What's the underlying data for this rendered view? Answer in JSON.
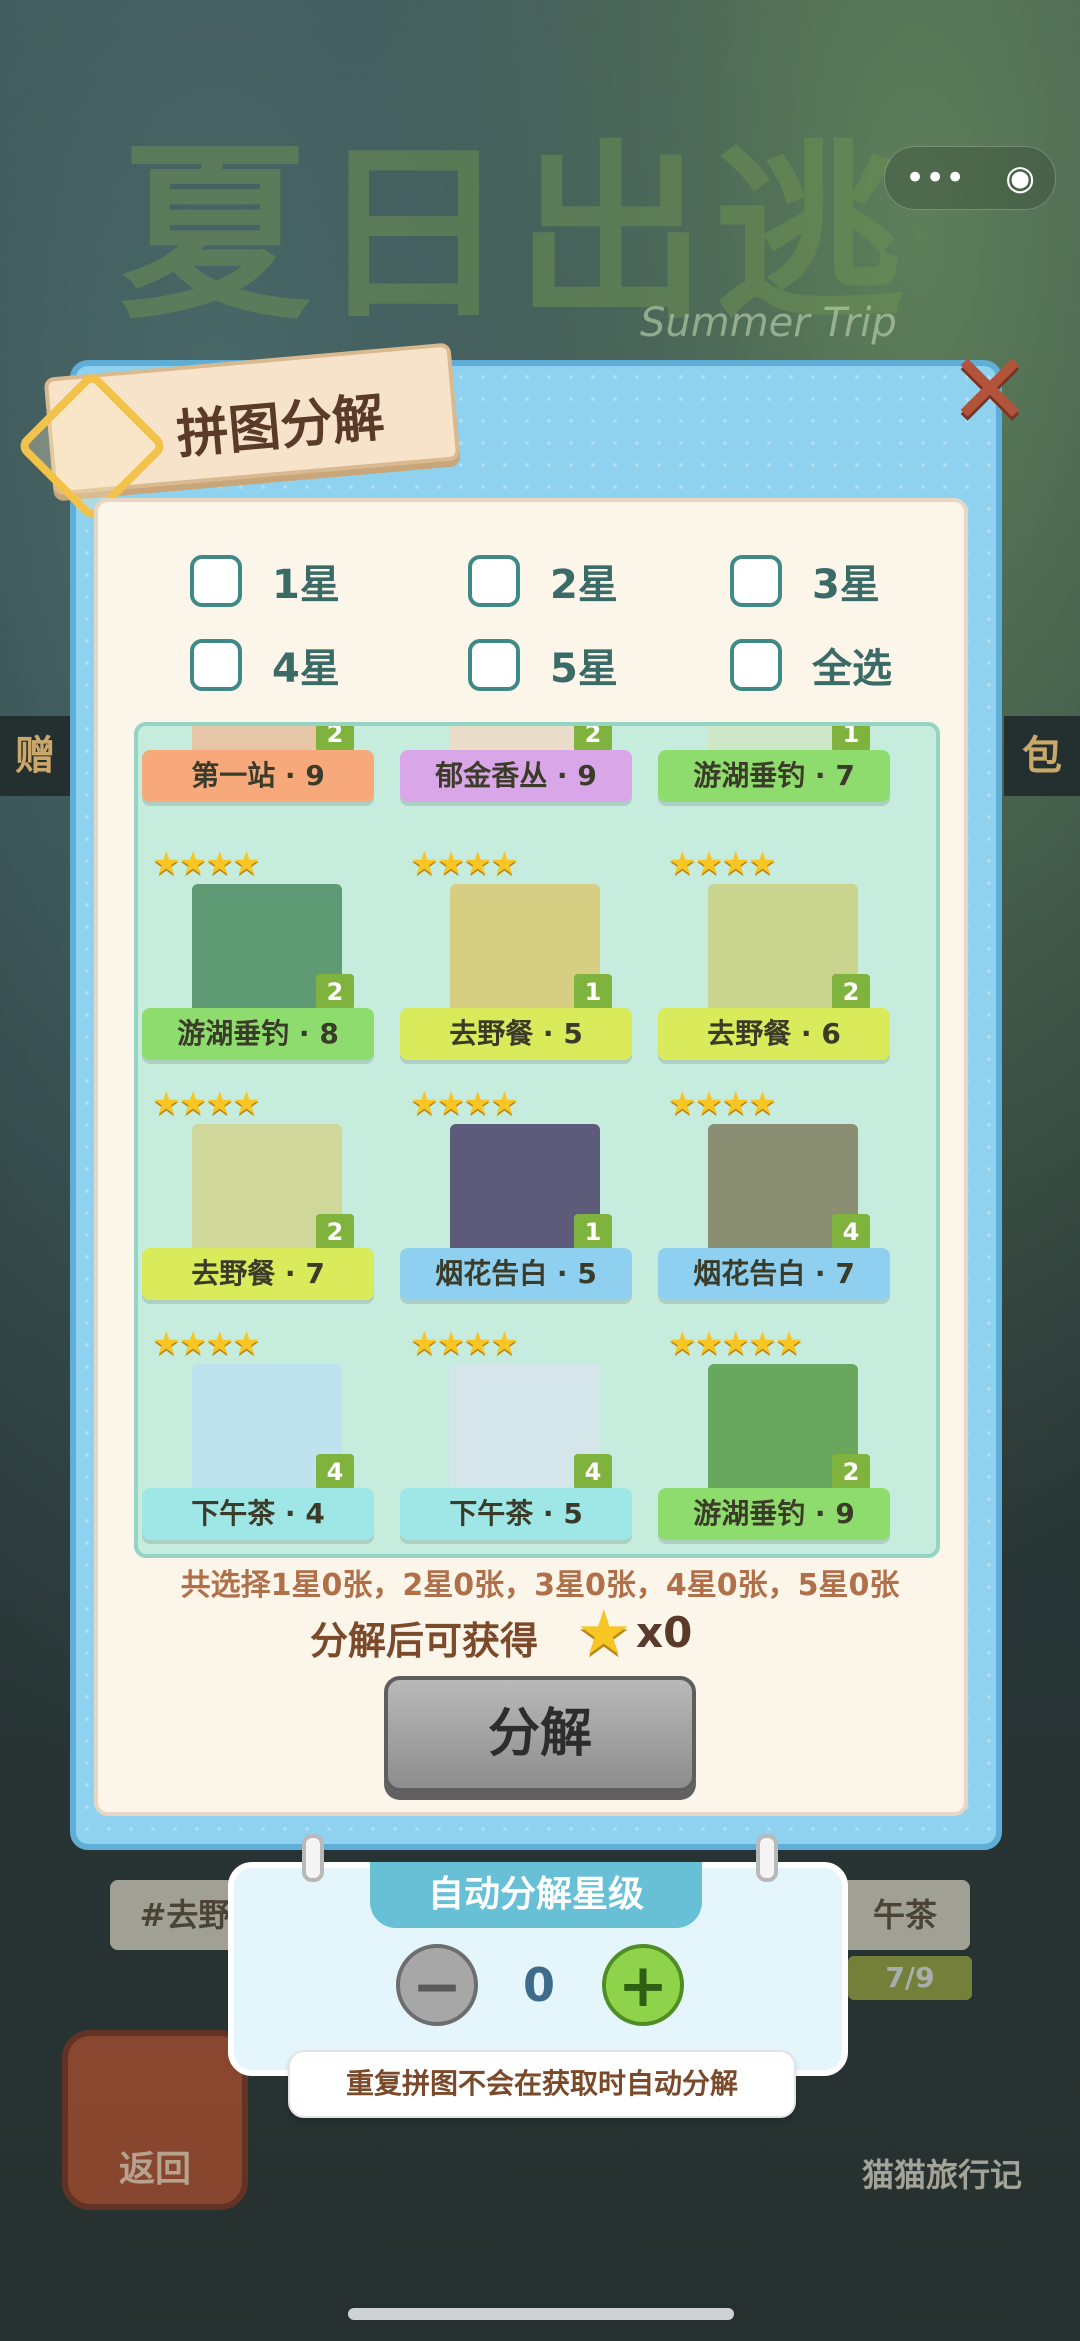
{
  "capsule": {
    "more": "•••",
    "target": "◉"
  },
  "background": {
    "title_art": "夏日出逃记",
    "title_sub": "Summer Trip",
    "left_tab": "赠",
    "right_tab": "包",
    "back_label": "返回",
    "logo": "猫猫旅行记",
    "bottom_left_tag": "#去野",
    "bottom_right_tag": "午茶",
    "progress_fragment": "7/9"
  },
  "modal": {
    "title": "拼图分解",
    "close_icon": "close-x-icon",
    "filters": [
      {
        "label": "1星"
      },
      {
        "label": "2星"
      },
      {
        "label": "3星"
      },
      {
        "label": "4星"
      },
      {
        "label": "5星"
      },
      {
        "label": "全选"
      }
    ],
    "cards": [
      {
        "name": "第一站 · 9",
        "stars": "",
        "count": "2",
        "ribbon_color": "#f7a97c",
        "art": "#e6c6a6"
      },
      {
        "name": "郁金香丛 · 9",
        "stars": "",
        "count": "2",
        "ribbon_color": "#d9a7e8",
        "art": "#e9dcc8"
      },
      {
        "name": "游湖垂钓 · 7",
        "stars": "",
        "count": "1",
        "ribbon_color": "#8fdc6e",
        "art": "#cfe7c9"
      },
      {
        "name": "游湖垂钓 · 8",
        "stars": "★★★★",
        "count": "2",
        "ribbon_color": "#8fdc6e",
        "art": "#5e9a73"
      },
      {
        "name": "去野餐 · 5",
        "stars": "★★★★",
        "count": "1",
        "ribbon_color": "#d9ea5a",
        "art": "#d6cf83"
      },
      {
        "name": "去野餐 · 6",
        "stars": "★★★★",
        "count": "2",
        "ribbon_color": "#d9ea5a",
        "art": "#c9d48e"
      },
      {
        "name": "去野餐 · 7",
        "stars": "★★★★",
        "count": "2",
        "ribbon_color": "#d9ea5a",
        "art": "#cfd79a"
      },
      {
        "name": "烟花告白 · 5",
        "stars": "★★★★",
        "count": "1",
        "ribbon_color": "#8fd0f0",
        "art": "#5e5a7a"
      },
      {
        "name": "烟花告白 · 7",
        "stars": "★★★★",
        "count": "4",
        "ribbon_color": "#8fd0f0",
        "art": "#8a8f74"
      },
      {
        "name": "下午茶 · 4",
        "stars": "★★★★",
        "count": "4",
        "ribbon_color": "#9fe6e6",
        "art": "#bfe3ee"
      },
      {
        "name": "下午茶 · 5",
        "stars": "★★★★",
        "count": "4",
        "ribbon_color": "#9fe6e6",
        "art": "#d5e6ea"
      },
      {
        "name": "游湖垂钓 · 9",
        "stars": "★★★★★",
        "count": "2",
        "ribbon_color": "#8fdc6e",
        "art": "#6aa75e"
      }
    ],
    "summary": "共选择1星0张，2星0张，3星0张，4星0张，5星0张",
    "reward_label": "分解后可获得",
    "reward_icon": "star-icon",
    "reward_value": "x0",
    "decompose_button": "分解"
  },
  "auto": {
    "title": "自动分解星级",
    "minus": "−",
    "plus": "+",
    "value": "0",
    "tip": "重复拼图不会在获取时自动分解"
  }
}
